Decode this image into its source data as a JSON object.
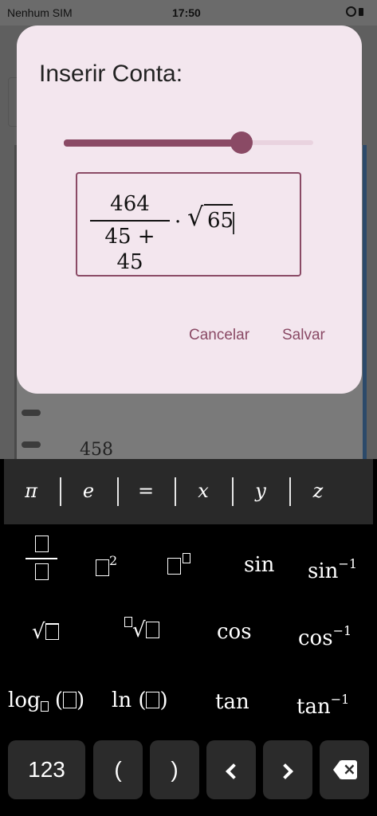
{
  "status_bar": {
    "carrier": "Nenhum SIM",
    "time": "17:50",
    "icons": [
      "alarm-icon",
      "battery-icon"
    ]
  },
  "background": {
    "visible_value": "458"
  },
  "dialog": {
    "title": "Inserir Conta:",
    "slider_value": 0.72,
    "expression": {
      "numerator": "464",
      "denominator": "45 + 45",
      "operator": "·",
      "sqrt_radicand": "65"
    },
    "cancel_label": "Cancelar",
    "save_label": "Salvar"
  },
  "keyboard": {
    "variables": [
      "π",
      "e",
      "=",
      "x",
      "y",
      "z"
    ],
    "functions": {
      "square_sup": "2",
      "sin": "sin",
      "sin_inv": "sin",
      "inv_sup": "−1",
      "cos": "cos",
      "cos_inv": "cos",
      "tan": "tan",
      "tan_inv": "tan",
      "log": "log",
      "ln": "ln"
    },
    "bottom": {
      "numbers": "123",
      "lparen": "(",
      "rparen": ")"
    },
    "icons": [
      "chevron-left-icon",
      "chevron-right-icon",
      "backspace-icon"
    ]
  },
  "colors": {
    "accent": "#8a4a65",
    "dialog_bg": "#f3e6ee",
    "key_bg": "#2b2b2b"
  }
}
